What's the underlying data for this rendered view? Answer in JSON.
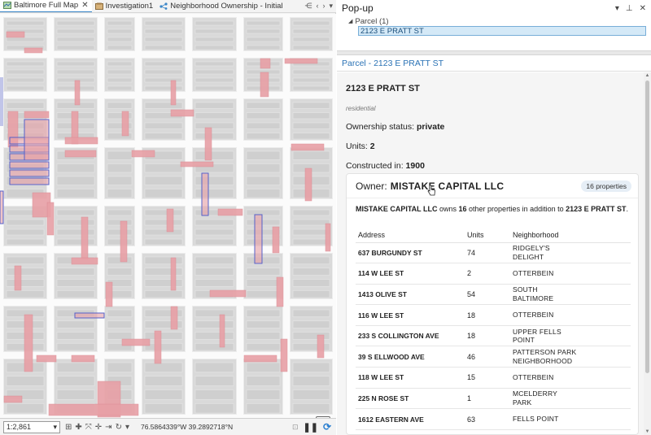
{
  "map_tabs": [
    {
      "label": "Baltimore Full Map",
      "active": true
    },
    {
      "label": "Investigation1",
      "active": false
    },
    {
      "label": "Neighborhood Ownership - Initial",
      "active": false
    }
  ],
  "statusbar": {
    "scale": "1:2,861",
    "coordinates": "76.5864339°W 39.2892718°N"
  },
  "popup": {
    "title": "Pop-up",
    "layer_group": "Parcel (1)",
    "selected_feature": "2123 E PRATT ST",
    "panel_title": "Parcel - 2123 E PRATT ST"
  },
  "parcel": {
    "address": "2123 E PRATT ST",
    "use": "residential",
    "ownership_label": "Ownership status:",
    "ownership_value": "private",
    "units_label": "Units:",
    "units_value": "2",
    "constructed_label": "Constructed in:",
    "constructed_value": "1900"
  },
  "owner": {
    "label": "Owner:",
    "name": "MISTAKE CAPITAL LLC",
    "badge": "16 properties",
    "summary_owner": "MISTAKE CAPITAL LLC",
    "summary_owns": " owns ",
    "summary_count": "16",
    "summary_mid": " other properties in addition to ",
    "summary_address": "2123 E PRATT ST",
    "summary_end": "."
  },
  "properties_table": {
    "headers": [
      "Address",
      "Units",
      "Neighborhood"
    ],
    "rows": [
      {
        "address": "637 BURGUNDY ST",
        "units": "74",
        "neighborhood": [
          "RIDGELY'S",
          "DELIGHT"
        ]
      },
      {
        "address": "114 W LEE ST",
        "units": "2",
        "neighborhood": [
          "OTTERBEIN"
        ]
      },
      {
        "address": "1413 OLIVE ST",
        "units": "54",
        "neighborhood": [
          "SOUTH",
          "BALTIMORE"
        ]
      },
      {
        "address": "116 W LEE ST",
        "units": "18",
        "neighborhood": [
          "OTTERBEIN"
        ]
      },
      {
        "address": "233 S COLLINGTON AVE",
        "units": "18",
        "neighborhood": [
          "UPPER FELLS",
          "POINT"
        ]
      },
      {
        "address": "39 S ELLWOOD AVE",
        "units": "46",
        "neighborhood": [
          "PATTERSON PARK",
          "NEIGHBORHOOD"
        ]
      },
      {
        "address": "118 W LEE ST",
        "units": "15",
        "neighborhood": [
          "OTTERBEIN"
        ]
      },
      {
        "address": "225 N ROSE ST",
        "units": "1",
        "neighborhood": [
          "MCELDERRY",
          "PARK"
        ]
      },
      {
        "address": "1612 EASTERN AVE",
        "units": "63",
        "neighborhood": [
          "FELLS POINT"
        ]
      }
    ]
  },
  "colors": {
    "accent": "#2a72b5",
    "parcel_highlight": "#e8a0a6",
    "owner_selection": "#5560c8",
    "tree_selection": "#d4e9f7"
  }
}
